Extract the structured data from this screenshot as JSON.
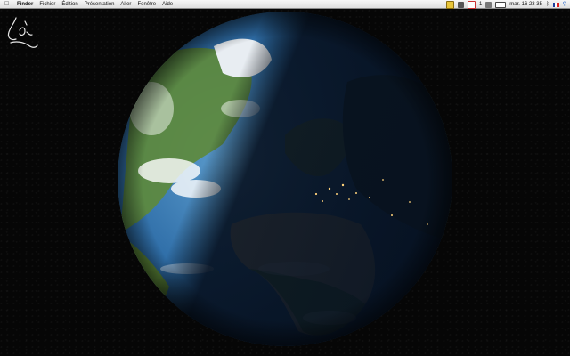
{
  "menubar": {
    "apple_icon": "apple-logo-icon",
    "items": [
      "Finder",
      "Fichier",
      "Édition",
      "Présentation",
      "Aller",
      "Fenêtre",
      "Aide"
    ],
    "status": {
      "clock": "mar. 16 23 35",
      "icons": [
        "notes-icon",
        "speaker-icon",
        "mail-icon",
        "wifi-icon",
        "bluetooth-icon",
        "flag-fr-icon",
        "spotlight-icon"
      ],
      "counter": "1"
    }
  },
  "desktop": {
    "logo_icon": "signature-logo-icon",
    "wallpaper": "earth-day-night-icon"
  },
  "colors": {
    "ocean": "#2f6ea8",
    "land": "#c8b48a",
    "forest": "#5e8a3a",
    "night": "#0d1a33"
  }
}
